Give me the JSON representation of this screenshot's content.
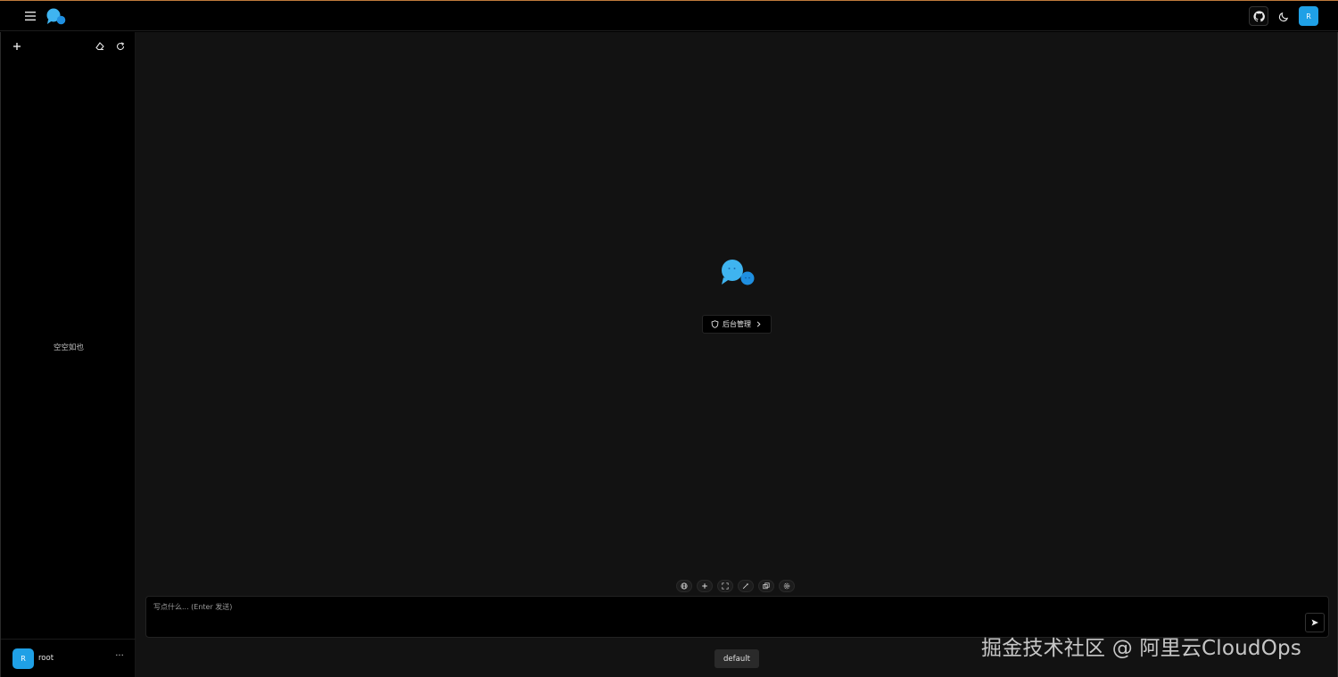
{
  "header": {
    "menu_icon": "hamburger-menu-icon",
    "logo_icon": "chat-bubbles-logo-icon",
    "github_icon": "github-icon",
    "theme_icon": "moon-icon",
    "avatar_initial": "R"
  },
  "sidebar": {
    "new_chat_icon": "plus-icon",
    "clear_icon": "eraser-icon",
    "refresh_icon": "refresh-icon",
    "empty_text": "空空如也",
    "user": {
      "avatar_initial": "R",
      "name": "root",
      "more_label": "···"
    }
  },
  "main": {
    "center_logo_icon": "chat-bubbles-logo-icon",
    "admin_button_label": "后台管理",
    "toolbar_chips": [
      "globe-icon",
      "plus-icon",
      "fullscreen-icon",
      "magic-wand-icon",
      "prompt-icon",
      "settings-icon"
    ],
    "composer": {
      "placeholder": "写点什么... (Enter 发送)",
      "value": ""
    },
    "send_icon": "send-arrow-icon",
    "model_label": "default"
  },
  "watermark": "掘金技术社区 @ 阿里云CloudOps",
  "colors": {
    "accent": "#1fa0e6",
    "background": "#121212",
    "sidebar": "#000000",
    "top_border": "#c07a3c"
  }
}
